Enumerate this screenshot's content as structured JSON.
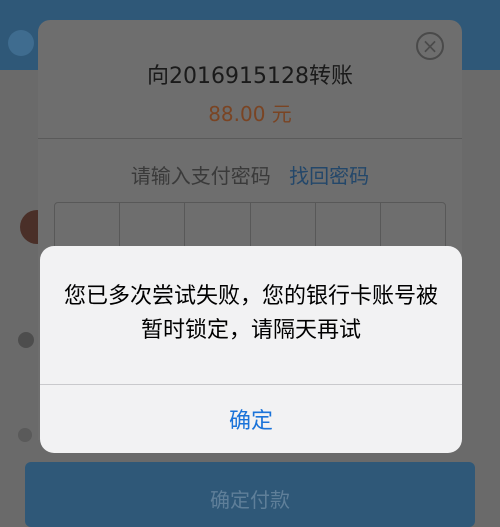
{
  "background": {
    "bottom_button_label": "确定付款"
  },
  "payment": {
    "title": "向2016915128转账",
    "amount": "88.00 元",
    "prompt": "请输入支付密码",
    "forgot_link": "找回密码",
    "close_icon": "close-icon",
    "pin_length": 6
  },
  "alert": {
    "message": "您已多次尝试失败，您的银行卡账号被暂时锁定，请隔天再试",
    "confirm_label": "确定"
  },
  "colors": {
    "amount": "#e07a3a",
    "link": "#1a73d9",
    "app_header": "#2f5878"
  }
}
